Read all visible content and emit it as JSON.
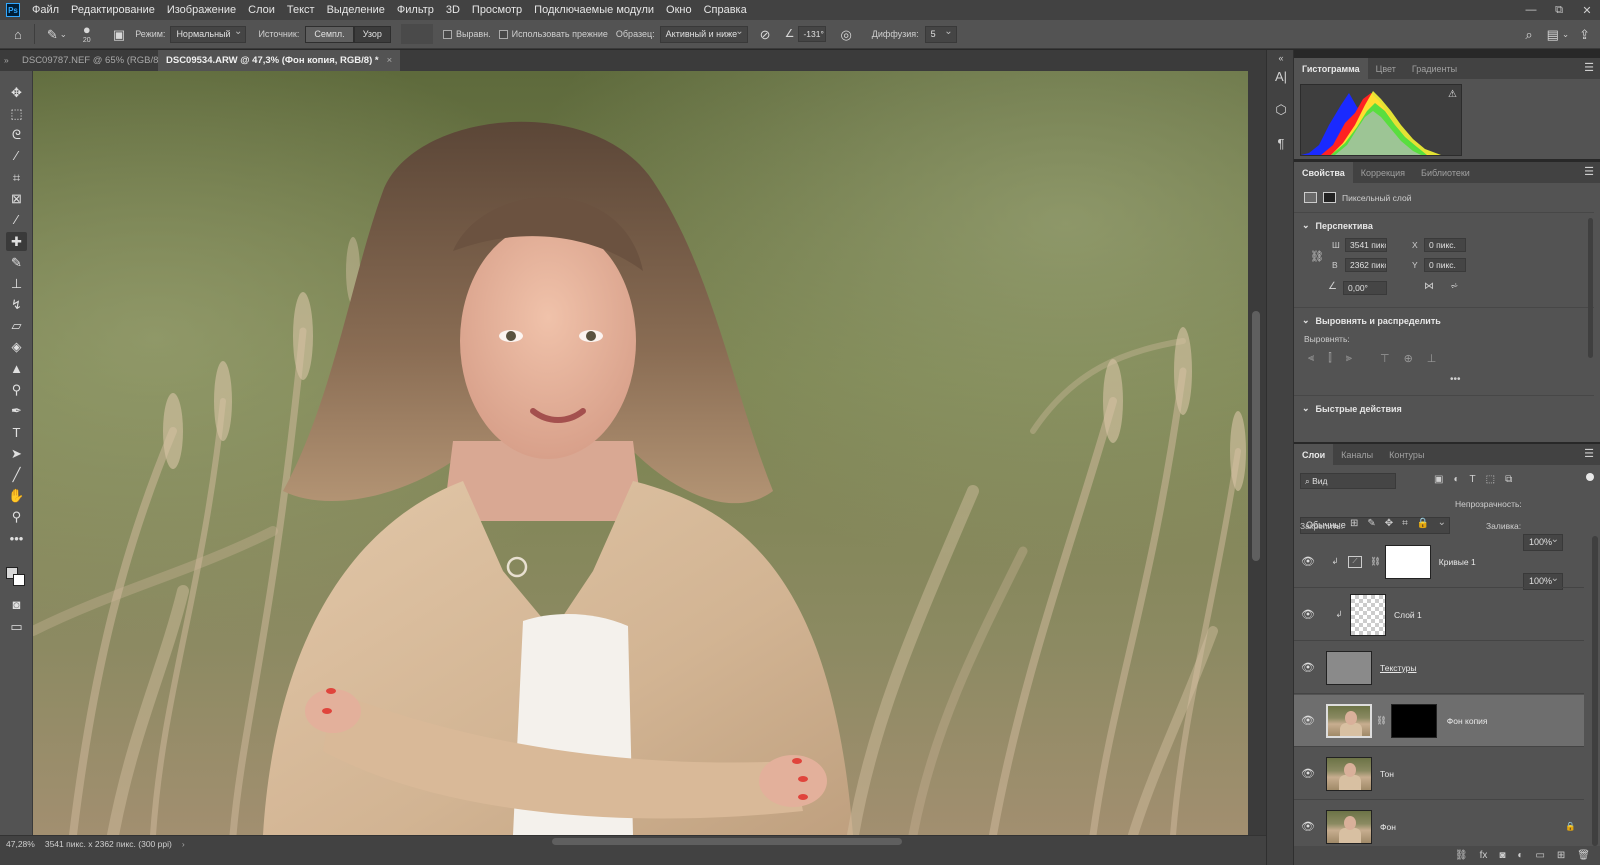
{
  "app": {
    "logo": "Ps"
  },
  "menu": [
    "Файл",
    "Редактирование",
    "Изображение",
    "Слои",
    "Текст",
    "Выделение",
    "Фильтр",
    "3D",
    "Просмотр",
    "Подключаемые модули",
    "Окно",
    "Справка"
  ],
  "window_controls": {
    "minimize": "—",
    "restore": "⧉",
    "close": "✕"
  },
  "options": {
    "brush_size": "20",
    "mode_label": "Режим:",
    "mode_value": "Нормальный",
    "source_label": "Источник:",
    "source_sampled": "Семпл.",
    "source_pattern": "Узор",
    "aligned_label": "Выравн.",
    "use_legacy_label": "Использовать прежние",
    "sample_label": "Образец:",
    "sample_value": "Активный и ниже",
    "angle_value": "-131°",
    "diffusion_label": "Диффузия:",
    "diffusion_value": "5"
  },
  "tabs": [
    {
      "title": "DSC09787.NEF @ 65% (RGB/8)",
      "active": false
    },
    {
      "title": "DSC09534.ARW @ 47,3% (Фон копия, RGB/8) *",
      "active": true
    }
  ],
  "status": {
    "zoom": "47,28%",
    "doc_info": "3541 пикс. x 2362 пикс. (300 ppi)"
  },
  "histogram_panel": {
    "tabs": [
      "Гистограмма",
      "Цвет",
      "Градиенты"
    ],
    "warning_icon": "⚠"
  },
  "properties_panel": {
    "tabs": [
      "Свойства",
      "Коррекция",
      "Библиотеки"
    ],
    "layer_type": "Пиксельный слой",
    "transform_section": "Перспектива",
    "w_label": "Ш",
    "w_value": "3541 пикс",
    "h_label": "В",
    "h_value": "2362 пикс",
    "x_label": "X",
    "x_value": "0 пикс.",
    "y_label": "Y",
    "y_value": "0 пикс.",
    "angle_value": "0,00°",
    "align_section": "Выровнять и распределить",
    "align_label": "Выровнять:",
    "quick_actions": "Быстрые действия"
  },
  "layers_panel": {
    "tabs": [
      "Слои",
      "Каналы",
      "Контуры"
    ],
    "filter_value": "Вид",
    "blend_mode": "Обычные",
    "opacity_label": "Непрозрачность:",
    "opacity_value": "100%",
    "lock_label": "Закрепить:",
    "fill_label": "Заливка:",
    "fill_value": "100%",
    "layers": [
      {
        "name": "Кривые 1"
      },
      {
        "name": "Слой 1"
      },
      {
        "name": "Текстуры"
      },
      {
        "name": "Фон копия"
      },
      {
        "name": "Тон"
      },
      {
        "name": "Фон"
      }
    ]
  },
  "colors": {
    "accent": "#31a8ff",
    "panel_bg": "#535353",
    "menu_bg": "#424242"
  }
}
